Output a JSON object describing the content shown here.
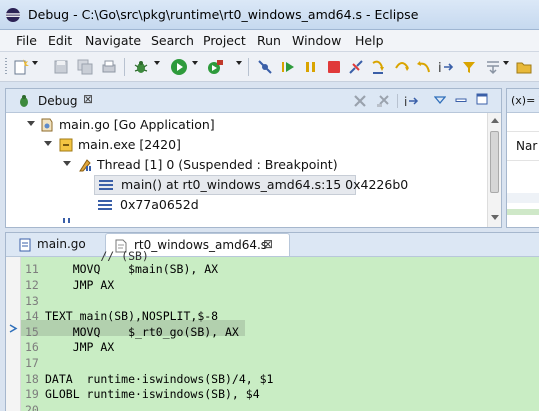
{
  "window": {
    "title": "Debug - C:\\Go\\src\\pkg\\runtime\\rt0_windows_amd64.s - Eclipse",
    "icon": "eclipse-icon"
  },
  "menu": [
    "File",
    "Edit",
    "Navigate",
    "Search",
    "Project",
    "Run",
    "Window",
    "Help"
  ],
  "debug_view": {
    "tab_label": "Debug",
    "close_glyph": "⊠",
    "tree": [
      {
        "label": "main.go [Go Application]"
      },
      {
        "label": "main.exe [2420]"
      },
      {
        "label": "Thread [1] 0 (Suspended : Breakpoint)"
      },
      {
        "label": "main() at rt0_windows_amd64.s:15 0x4226b0"
      },
      {
        "label": "0x77a0652d"
      }
    ]
  },
  "variables_view": {
    "tab_fragment": "(x)= V",
    "header_fragment": "Nar"
  },
  "editor": {
    "tabs": [
      {
        "label": "main.go"
      },
      {
        "label": "rt0_windows_amd64.s",
        "close_glyph": "⊠"
      }
    ],
    "partial_top": "        // (SB)",
    "lines": [
      {
        "n": "11",
        "text": "    MOVQ    $main(SB), AX"
      },
      {
        "n": "12",
        "text": "    JMP AX"
      },
      {
        "n": "13",
        "text": ""
      },
      {
        "n": "14",
        "text": "TEXT main(SB),NOSPLIT,$-8"
      },
      {
        "n": "15",
        "text": "    MOVQ    $_rt0_go(SB), AX"
      },
      {
        "n": "16",
        "text": "    JMP AX"
      },
      {
        "n": "17",
        "text": ""
      },
      {
        "n": "18",
        "text": "DATA  runtime·iswindows(SB)/4, $1"
      },
      {
        "n": "19",
        "text": "GLOBL runtime·iswindows(SB), $4"
      },
      {
        "n": "20",
        "text": ""
      }
    ],
    "current_line": "15"
  },
  "colors": {
    "code_bg": "#c9edc4",
    "current_line_bg": "#b2d0ae",
    "titlebar": "#c6d9ef",
    "accent": "#2f6fba"
  }
}
